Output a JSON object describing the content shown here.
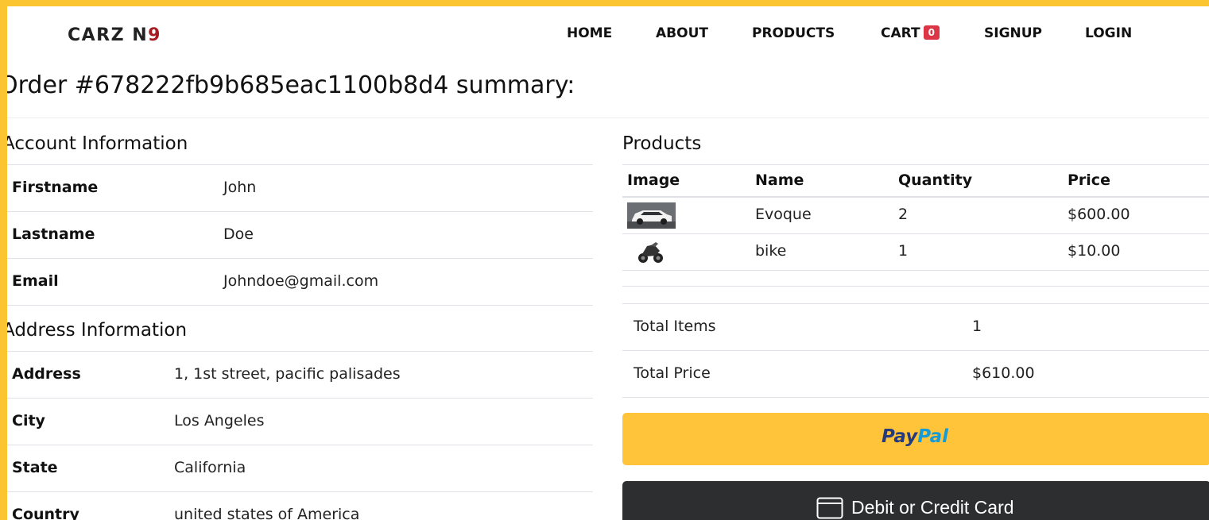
{
  "brand": {
    "name_part1": "CARZ N",
    "name_part2": "9"
  },
  "nav": {
    "home": "HOME",
    "about": "ABOUT",
    "products": "PRODUCTS",
    "cart": "CART",
    "cart_count": "0",
    "signup": "SIGNUP",
    "login": "LOGIN"
  },
  "order": {
    "title": "Order #678222fb9b685eac1100b8d4 summary:"
  },
  "account": {
    "heading": "Account Information",
    "rows": [
      {
        "label": "Firstname",
        "value": "John"
      },
      {
        "label": "Lastname",
        "value": "Doe"
      },
      {
        "label": "Email",
        "value": "Johndoe@gmail.com"
      }
    ]
  },
  "address": {
    "heading": "Address Information",
    "rows": [
      {
        "label": "Address",
        "value": "1, 1st street, pacific palisades"
      },
      {
        "label": "City",
        "value": "Los Angeles"
      },
      {
        "label": "State",
        "value": "California"
      },
      {
        "label": "Country",
        "value": "united states of America"
      }
    ]
  },
  "products": {
    "heading": "Products",
    "columns": [
      "Image",
      "Name",
      "Quantity",
      "Price"
    ],
    "rows": [
      {
        "image": "suv-thumbnail-icon",
        "name": "Evoque",
        "quantity": "2",
        "price": "$600.00"
      },
      {
        "image": "motorbike-thumbnail-icon",
        "name": "bike",
        "quantity": "1",
        "price": "$10.00"
      }
    ]
  },
  "totals": {
    "items_label": "Total Items",
    "items_value": "1",
    "price_label": "Total Price",
    "price_value": "$610.00"
  },
  "payment": {
    "paypal_part1": "Pay",
    "paypal_part2": "Pal",
    "card_label": "Debit or Credit Card"
  },
  "colors": {
    "frame": "#fbc531",
    "brand_accent": "#a51d22",
    "badge": "#dc3545",
    "paypal_button": "#ffc439",
    "card_button": "#2c2e2f"
  }
}
